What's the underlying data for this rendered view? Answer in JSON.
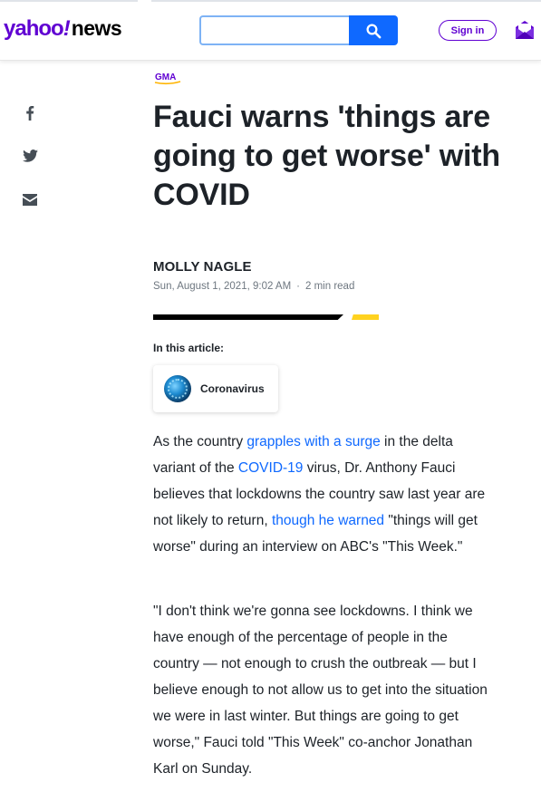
{
  "header": {
    "logo_yahoo": "yahoo",
    "logo_bang": "!",
    "logo_news": "news",
    "search_value": "",
    "signin_label": "Sign in"
  },
  "article": {
    "source_badge": "GMA",
    "title": "Fauci warns 'things are going to get worse' with COVID",
    "author": "MOLLY NAGLE",
    "date": "Sun, August 1, 2021, 9:02 AM",
    "separator": "·",
    "read_time": "2 min read",
    "in_this_article_label": "In this article:",
    "topic": "Coronavirus",
    "p1": {
      "t1": "As the country ",
      "link1": "grapples with a surge",
      "t2": " in the delta variant of the ",
      "link2": "COVID-19",
      "t3": " virus, Dr. Anthony Fauci believes that lockdowns the country saw last year are not likely to return, ",
      "link3": "though he warned",
      "t4": " \"things will get worse\" during an interview on ABC's \"This Week.\""
    },
    "p2": "\"I don't think we're gonna see lockdowns. I think we have enough of the percentage of people in the country — not enough to crush the outbreak — but I believe enough to not allow us to get into the situation we were in last winter. But things are going to get worse,\" Fauci told \"This Week\" co-anchor Jonathan Karl on Sunday."
  },
  "colors": {
    "brand_purple": "#6001d2",
    "link_blue": "#0f69ff",
    "accent_yellow": "#ffd21f"
  },
  "icons": [
    "search-icon",
    "mail-icon",
    "facebook-icon",
    "twitter-icon",
    "email-icon"
  ]
}
